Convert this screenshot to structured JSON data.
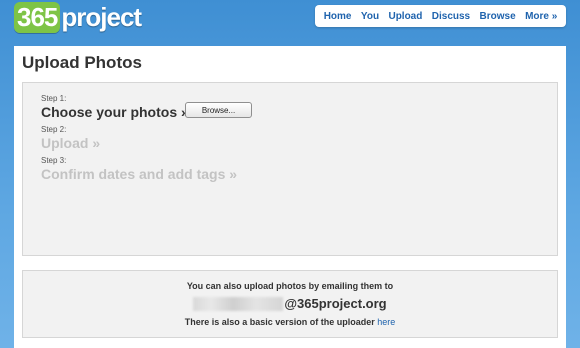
{
  "header": {
    "logo_number": "365",
    "logo_word": "project"
  },
  "nav": {
    "items": [
      {
        "label": "Home"
      },
      {
        "label": "You"
      },
      {
        "label": "Upload"
      },
      {
        "label": "Discuss"
      },
      {
        "label": "Browse"
      },
      {
        "label": "More »"
      }
    ]
  },
  "page": {
    "title": "Upload Photos"
  },
  "steps": [
    {
      "number": "Step 1:",
      "title": "Choose your photos »",
      "active": true
    },
    {
      "number": "Step 2:",
      "title": "Upload »",
      "active": false
    },
    {
      "number": "Step 3:",
      "title": "Confirm dates and add tags »",
      "active": false
    }
  ],
  "browse_button": {
    "label": "Browse..."
  },
  "email_upload": {
    "intro": "You can also upload photos by emailing them to",
    "domain": "@365project.org",
    "basic_text": "There is also a basic version of the uploader",
    "basic_link": "here"
  }
}
